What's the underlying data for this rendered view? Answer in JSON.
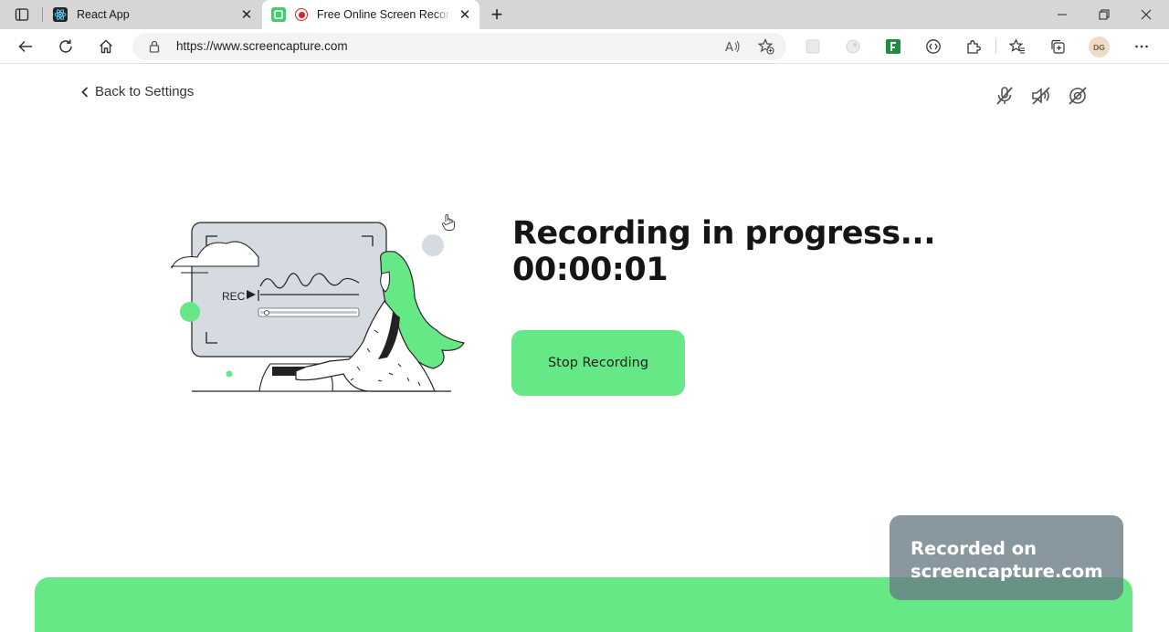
{
  "browser": {
    "tabs": [
      {
        "title": "React App",
        "active": false,
        "favicon": "react-logo-icon"
      },
      {
        "title": "Free Online Screen Recorder",
        "active": true,
        "favicon": "screencapture-logo-icon",
        "status": "recording-dot-icon"
      }
    ],
    "address_bar": {
      "url": "https://www.screencapture.com"
    },
    "profile_initials": "DG"
  },
  "page": {
    "back_link": "Back to Settings",
    "media_toggles": [
      "microphone-off-icon",
      "speaker-off-icon",
      "camera-off-icon"
    ],
    "heading": "Recording in progress...",
    "timer": "00:00:01",
    "stop_button": "Stop Recording",
    "illustration": {
      "rec_label": "REC"
    },
    "watermark": {
      "line1": "Recorded on",
      "line2": "screencapture.com"
    }
  },
  "colors": {
    "accent_green": "#67e887",
    "text_dark": "#151515",
    "watermark_bg": "#687b83",
    "tabbar_bg": "#d6d6d6"
  }
}
